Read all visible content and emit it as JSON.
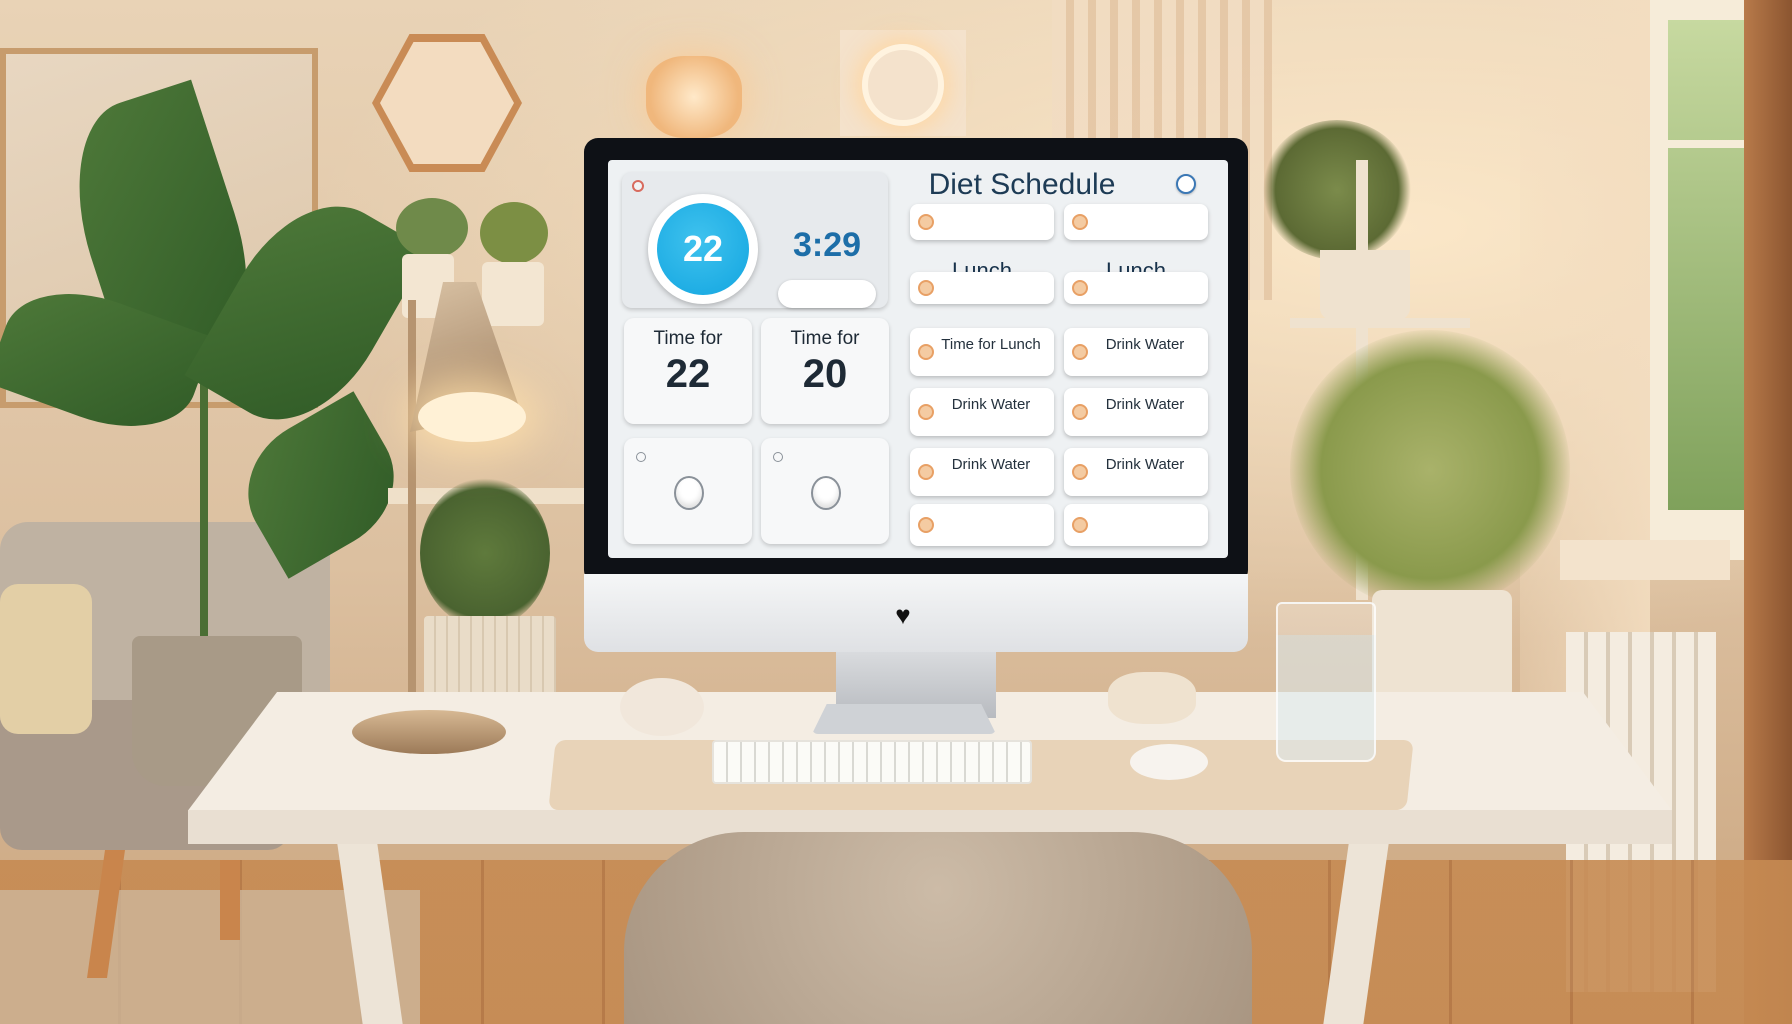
{
  "app": {
    "title": "Diet Schedule"
  },
  "clock": {
    "day": "22",
    "time": "3:29",
    "button_label": "",
    "indicator_icon": "red-dot-icon"
  },
  "countdowns": [
    {
      "label": "Time for",
      "value": "22",
      "sub": ""
    },
    {
      "label": "Time for",
      "value": "20",
      "sub": ""
    }
  ],
  "mini_cards": [
    {
      "label": "",
      "icon": "ring-icon",
      "sub": ""
    },
    {
      "label": "",
      "icon": "spiral-icon",
      "sub": ""
    }
  ],
  "schedule": {
    "column_heads": [
      "Lunch",
      "Lunch"
    ],
    "rows": [
      [
        "",
        ""
      ],
      [
        "",
        ""
      ],
      [
        "Time for Lunch",
        "Drink Water"
      ],
      [
        "Drink Water",
        "Drink Water"
      ],
      [
        "Drink Water",
        "Drink Water"
      ],
      [
        "",
        ""
      ]
    ],
    "item_icon": "alarm-dot-icon",
    "accent_color": "#e8a065"
  },
  "colors": {
    "accent_blue": "#12a5e0",
    "time_blue": "#1d6ea8",
    "bezel": "#0e1116",
    "screen_bg": "#eef1f3"
  }
}
